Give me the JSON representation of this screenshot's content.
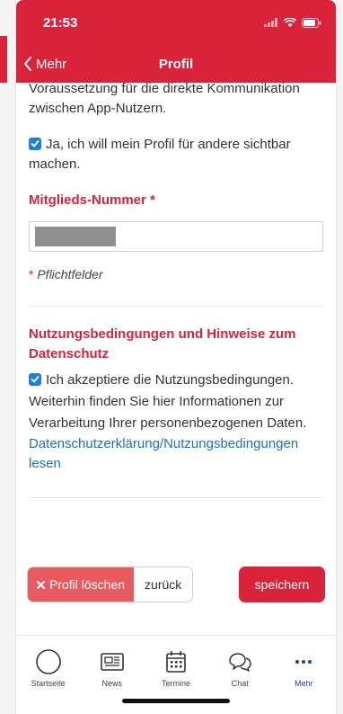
{
  "status_bar": {
    "time": "21:53"
  },
  "nav": {
    "back_label": "Mehr",
    "title": "Profil"
  },
  "content": {
    "intro_text": "Voraussetzung für die direkte Kommunikation zwischen App-Nutzern.",
    "visibility_checkbox_label": "Ja, ich will mein Profil für andere sichtbar machen.",
    "member_number_label": "Mitglieds-Nummer",
    "required_star": "*",
    "required_note_star": "*",
    "required_note": "Pflichtfelder",
    "terms_heading": "Nutzungsbedingungen und Hinweise zum Datenschutz",
    "terms_checkbox_text": "Ich akzeptiere die Nutzungsbedingungen. Weiterhin finden Sie hier Informationen zur Verarbeitung Ihrer personenbezogenen Daten.",
    "terms_link": "Datenschutzerklärung/Nutzungsbedingungen lesen"
  },
  "actions": {
    "delete_label": "Profil löschen",
    "back_label": "zurück",
    "save_label": "speichern"
  },
  "tabbar": {
    "items": [
      {
        "label": "Startseite",
        "icon": "circle-icon"
      },
      {
        "label": "News",
        "icon": "newspaper-icon"
      },
      {
        "label": "Termine",
        "icon": "calendar-icon"
      },
      {
        "label": "Chat",
        "icon": "chat-bubbles-icon"
      },
      {
        "label": "Mehr",
        "icon": "more-dots-icon",
        "active": true
      }
    ]
  },
  "colors": {
    "brand_red": "#d9233a",
    "checkbox_blue": "#1f7fd6",
    "link_blue": "#1f6fc0",
    "active_tab": "#1f3f8f"
  }
}
